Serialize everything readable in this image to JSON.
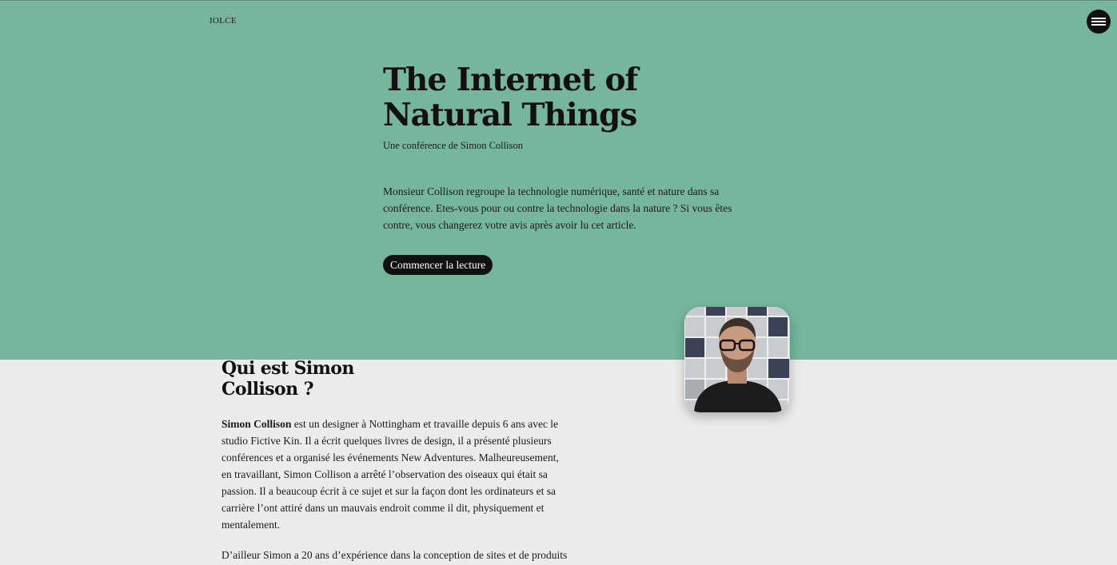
{
  "site": {
    "logo": "IOLCE"
  },
  "menu": {
    "icon": "hamburger-menu-icon"
  },
  "hero": {
    "title_line1": "The Internet of",
    "title_line2": "Natural Things",
    "subtitle": "Une conférence de Simon Collison",
    "intro": "Monsieur Collison regroupe la technologie numérique, santé et nature dans sa conférence. Etes-vous pour ou contre la technologie dans la nature ? Si vous êtes contre, vous changerez votre avis après avoir lu cet article.",
    "cta_label": "Commencer la lecture"
  },
  "about": {
    "title_line1": "Qui est Simon",
    "title_line2": "Collison ?",
    "bio_name": "Simon Collison",
    "bio_text": " est un designer à Nottingham et travaille depuis 6 ans avec le studio Fictive Kin. Il a écrit quelques livres de design, il a présenté plusieurs conférences et a organisé les événements New Adventures. Malheureusement, en travaillant, Simon Collison a arrêté l’observation des oiseaux qui était sa passion. Il a beaucoup écrit à ce sujet et sur la façon dont les ordinateurs et sa carrière l’ont attiré dans un mauvais endroit comme il dit, physiquement et mentalement.",
    "bio_second": "D’ailleur Simon a 20 ans d’expérience dans la conception de sites et de produits"
  },
  "colors": {
    "hero_bg": "#75b69d",
    "page_bg": "#ececec",
    "button_bg": "#111111",
    "text": "#161616"
  }
}
